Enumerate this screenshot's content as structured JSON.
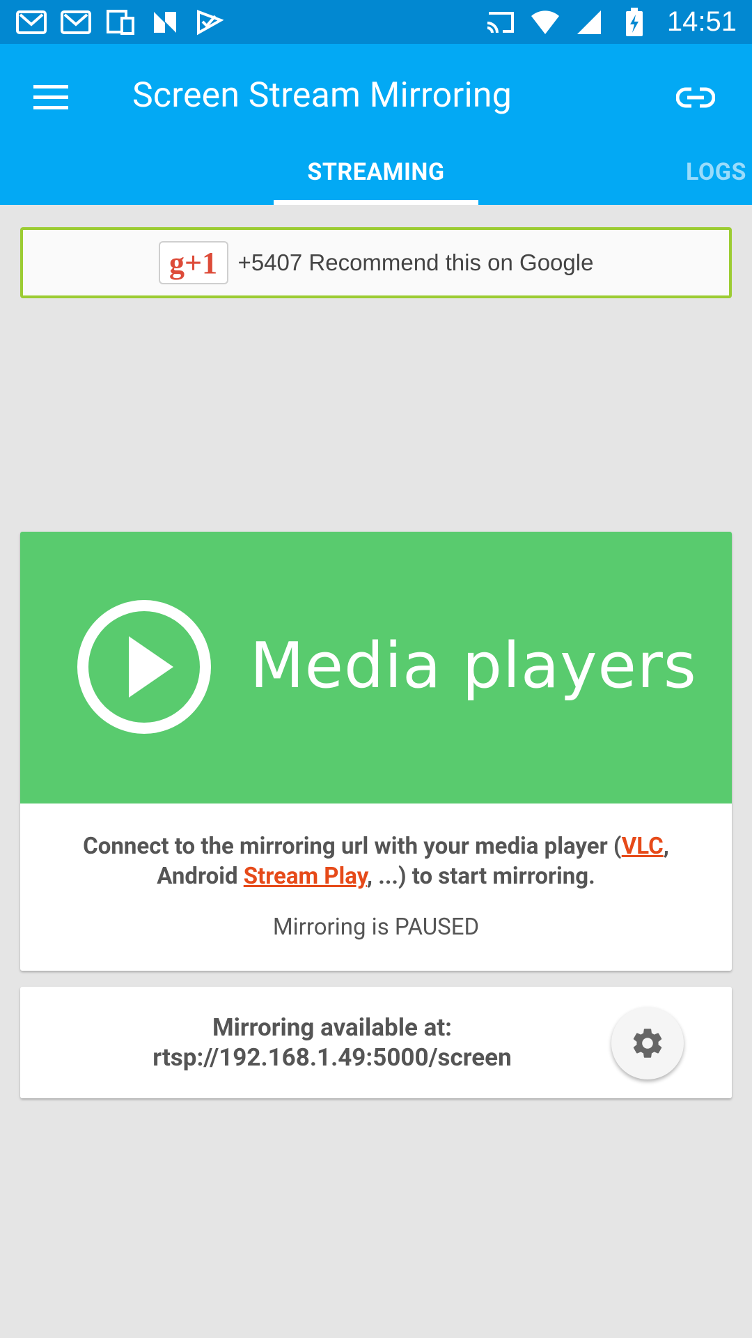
{
  "status_bar": {
    "time": "14:51",
    "left_icons": [
      "gmail-icon",
      "gmail-icon",
      "devices-icon",
      "n-app-icon",
      "check-flag-icon"
    ],
    "right_icons": [
      "cast-icon",
      "wifi-icon",
      "signal-icon",
      "battery-charging-icon"
    ]
  },
  "app_bar": {
    "title": "Screen Stream Mirroring",
    "tabs": [
      {
        "label": "STREAMING",
        "active": true
      },
      {
        "label": "LOGS",
        "active": false
      }
    ]
  },
  "gplus": {
    "badge": "g+1",
    "text": "+5407 Recommend this on Google"
  },
  "media_card": {
    "title": "Media players",
    "desc_prefix": "Connect to the mirroring url with your media player (",
    "link_vlc": "VLC",
    "desc_mid": ", Android ",
    "link_stream_play": "Stream Play",
    "desc_suffix": ", ...) to start mirroring.",
    "status": "Mirroring is PAUSED"
  },
  "url_card": {
    "line1": "Mirroring available at:",
    "line2": "rtsp://192.168.1.49:5000/screen"
  },
  "colors": {
    "status_bar": "#0288d1",
    "app_bar": "#03a9f4",
    "media_green": "#59cb6e",
    "link": "#e64a19",
    "gplus_border": "#9ccc33"
  }
}
